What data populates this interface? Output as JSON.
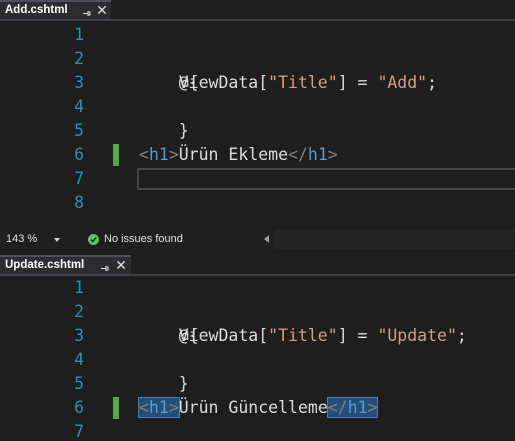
{
  "pane1": {
    "tab_name": "Add.cshtml",
    "line_numbers": [
      "1",
      "2",
      "3",
      "4",
      "5",
      "6",
      "7",
      "8"
    ],
    "code": {
      "l2_at_brace": "@{",
      "l3_viewdata": "    ViewData[",
      "l3_key": "\"Title\"",
      "l3_eq": "] = ",
      "l3_value": "\"Add\"",
      "l3_end": ";",
      "l4_close": "}",
      "l6_open_lt": "<",
      "l6_open_tag": "h1",
      "l6_open_gt": ">",
      "l6_text": "Ürün Ekleme",
      "l6_close_lt": "</",
      "l6_close_tag": "h1",
      "l6_close_gt": ">"
    }
  },
  "statusbar": {
    "zoom": "143 %",
    "issues": "No issues found"
  },
  "pane2": {
    "tab_name": "Update.cshtml",
    "line_numbers": [
      "1",
      "2",
      "3",
      "4",
      "5",
      "6",
      "7"
    ],
    "code": {
      "l2_at_brace": "@{",
      "l3_viewdata": "    ViewData[",
      "l3_key": "\"Title\"",
      "l3_eq": "] = ",
      "l3_value": "\"Update\"",
      "l3_end": ";",
      "l4_close": "}",
      "l6_open_lt": "<",
      "l6_open_tag": "h1",
      "l6_open_gt": ">",
      "l6_text": "Ürün Güncelleme",
      "l6_close_lt": "</",
      "l6_close_tag": "h1",
      "l6_close_gt": ">"
    }
  },
  "icons": {
    "pin": "pin-icon",
    "close": "close-icon",
    "ok": "check-circle-icon"
  },
  "colors": {
    "background": "#1e1e1e",
    "line_number": "#2b91af",
    "string": "#d69d85",
    "tag_name": "#569cd6",
    "change_marker": "#57a64a",
    "ok_green": "#4ec966"
  }
}
